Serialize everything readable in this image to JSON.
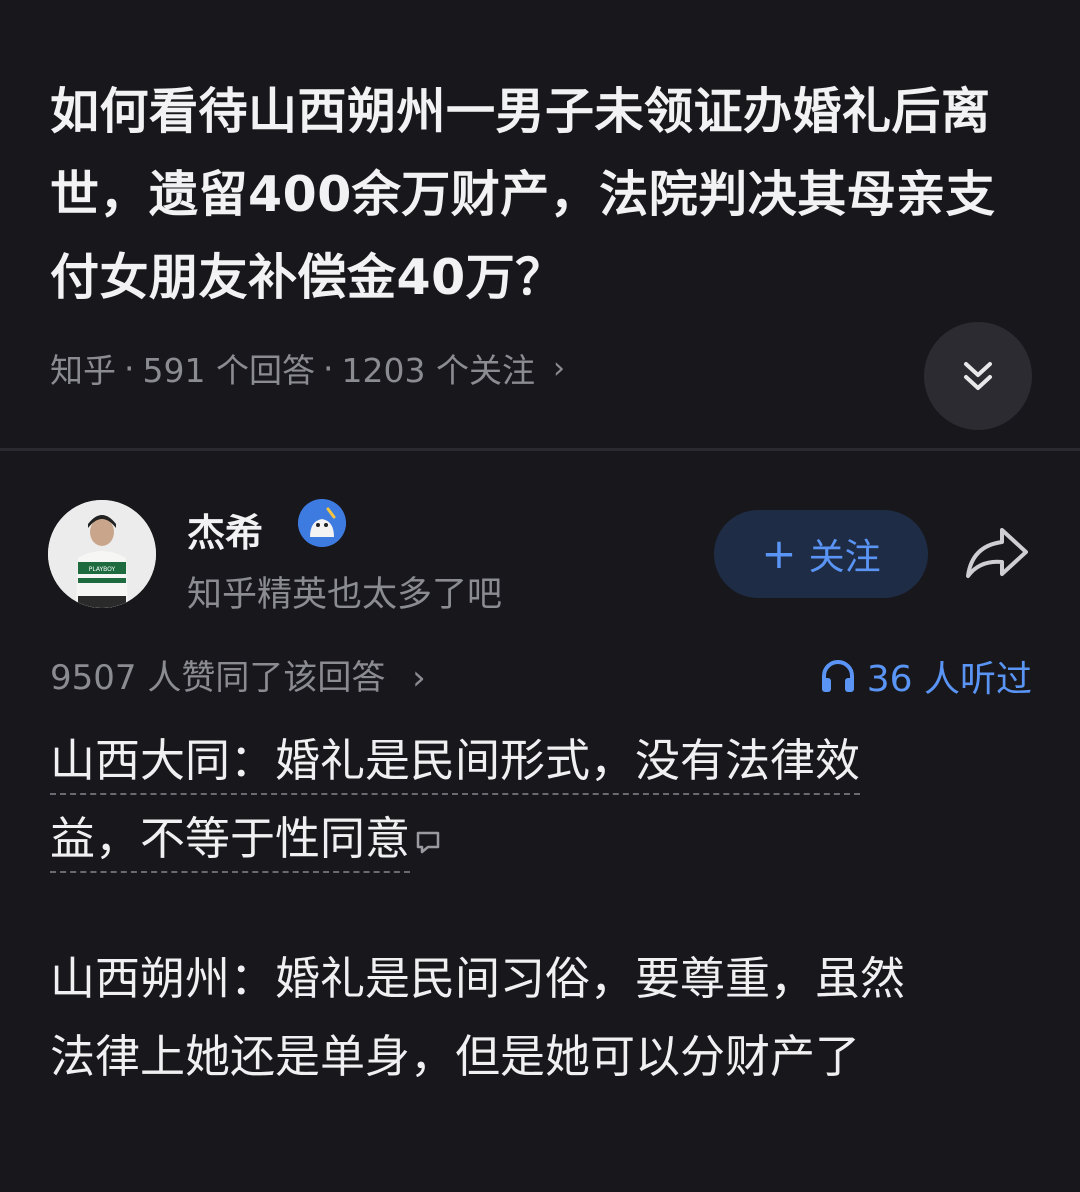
{
  "question": {
    "title": "如何看待山西朔州一男子未领证办婚礼后离世，遗留400余万财产，法院判决其母亲支付女朋友补偿金40万？",
    "source": "知乎",
    "answers": "591 个回答",
    "followers": "1203 个关注"
  },
  "author": {
    "name": "杰希",
    "bio": "知乎精英也太多了吧",
    "avatar_text": "PLAYBOY"
  },
  "actions": {
    "follow_label": "关注"
  },
  "stats": {
    "votes": "9507 人赞同了该回答",
    "listeners": "36 人听过"
  },
  "content": {
    "p1_line1": "山西大同：婚礼是民间形式，没有法律效",
    "p1_line2": "益，不等于性同意",
    "p2_line1": "山西朔州：婚礼是民间习俗，要尊重，虽然",
    "p2_line2": "法律上她还是单身，但是她可以分财产了"
  },
  "colors": {
    "background": "#18181c",
    "accent": "#5a95f5",
    "muted": "#8b8b92"
  },
  "icons": [
    "chevron-double-down-icon",
    "plus-icon",
    "share-icon",
    "headphones-icon",
    "comment-icon",
    "chevron-right-icon"
  ]
}
